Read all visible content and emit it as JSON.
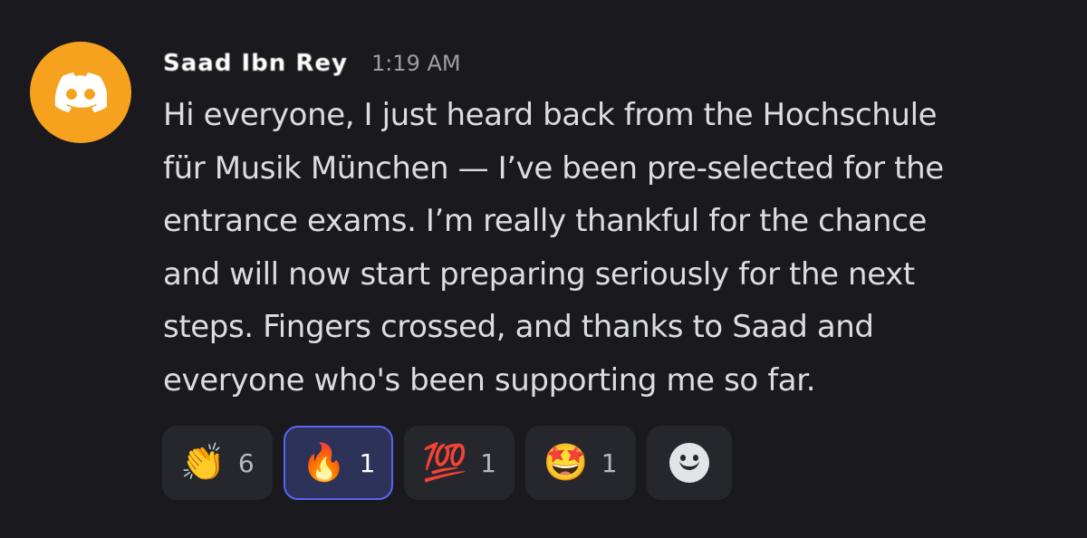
{
  "message": {
    "author": "Saad Ibn Rey",
    "timestamp": "1:19 AM",
    "lines": [
      "Hi everyone, I just heard back from the Hochschule",
      "für Musik München — I’ve been pre-selected for the",
      "entrance exams. I’m really thankful for the chance",
      "and will now start preparing seriously for the next",
      "steps. Fingers crossed, and thanks to Saad and",
      "everyone who's been supporting me so far."
    ]
  },
  "reactions": [
    {
      "emoji": "👏",
      "count": "6",
      "icon": "clapping-hands-icon",
      "active": false
    },
    {
      "emoji": "🔥",
      "count": "1",
      "icon": "fire-icon",
      "active": true
    },
    {
      "emoji": "💯",
      "count": "1",
      "icon": "hundred-points-icon",
      "active": false
    },
    {
      "emoji": "🤩",
      "count": "1",
      "icon": "star-struck-icon",
      "active": false
    }
  ],
  "add_reaction_icon": "smiley-add-reaction-icon",
  "colors": {
    "background": "#1a1a1e",
    "avatar": "#f6a21e",
    "active_reaction_border": "#5865f2",
    "active_reaction_bg": "#2d3259"
  }
}
